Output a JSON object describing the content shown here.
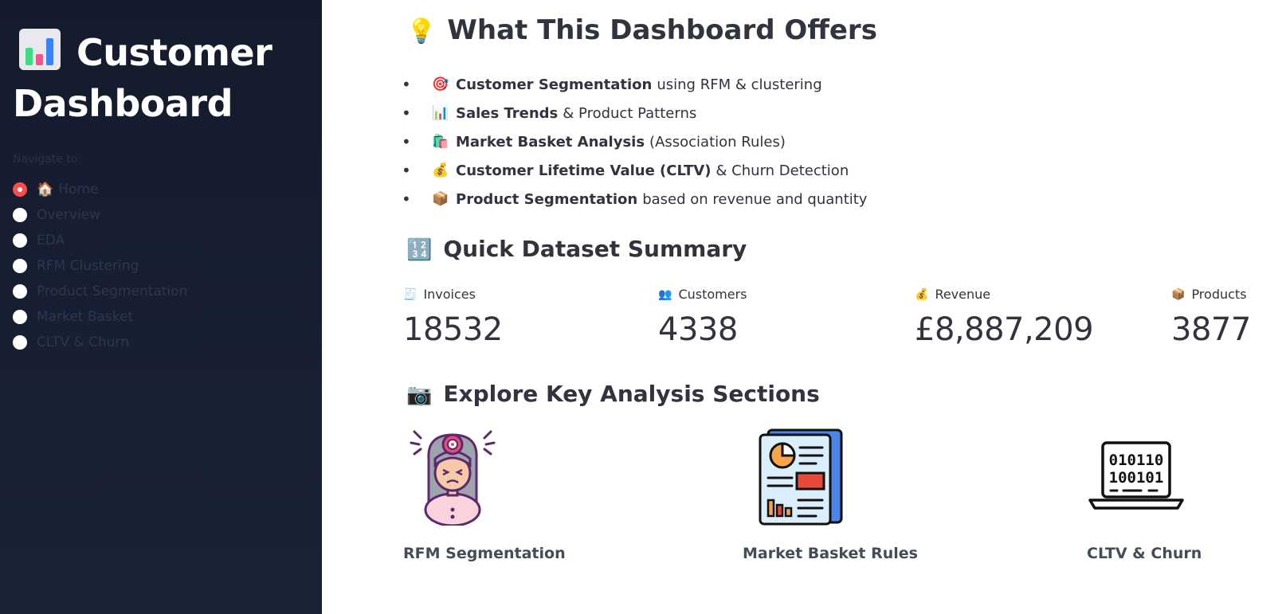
{
  "sidebar": {
    "title_line1": "Customer",
    "title_line2": "Dashboard",
    "nav_label": "Navigate to",
    "items": [
      {
        "label": "Home",
        "selected": true
      },
      {
        "label": "Overview"
      },
      {
        "label": "EDA"
      },
      {
        "label": "RFM Clustering"
      },
      {
        "label": "Product Segmentation"
      },
      {
        "label": "Market Basket"
      },
      {
        "label": "CLTV & Churn"
      }
    ]
  },
  "offers": {
    "heading": "What This Dashboard Offers",
    "items": [
      {
        "bold": "Customer Segmentation",
        "rest": "using RFM & clustering",
        "icon": "target-icon"
      },
      {
        "bold": "Sales Trends",
        "rest": "& Product Patterns",
        "icon": "bar-chart-icon"
      },
      {
        "bold": "Market Basket Analysis",
        "rest": "(Association Rules)",
        "icon": "shopping-bags-icon"
      },
      {
        "bold": "Customer Lifetime Value (CLTV)",
        "rest": "& Churn Detection",
        "icon": "money-bag-icon"
      },
      {
        "bold": "Product Segmentation",
        "rest": "based on revenue and quantity",
        "icon": "package-icon"
      }
    ]
  },
  "summary": {
    "heading": "Quick Dataset Summary",
    "metrics": [
      {
        "label": "Invoices",
        "value": "18532",
        "icon": "receipt-icon"
      },
      {
        "label": "Customers",
        "value": "4338",
        "icon": "people-icon"
      },
      {
        "label": "Revenue",
        "value": "£8,887,209",
        "icon": "money-bag-icon"
      },
      {
        "label": "Products",
        "value": "3877",
        "icon": "package-icon"
      }
    ]
  },
  "explore": {
    "heading": "Explore Key Analysis Sections",
    "cards": [
      {
        "caption": "RFM Segmentation",
        "icon": "stressed-person-target-icon"
      },
      {
        "caption": "Market Basket Rules",
        "icon": "report-document-icon"
      },
      {
        "caption": "CLTV & Churn",
        "icon": "binary-laptop-icon"
      }
    ]
  },
  "colors": {
    "sidebar_bg": "#141b2d",
    "accent": "#ff4b4b",
    "text": "#31333f"
  }
}
